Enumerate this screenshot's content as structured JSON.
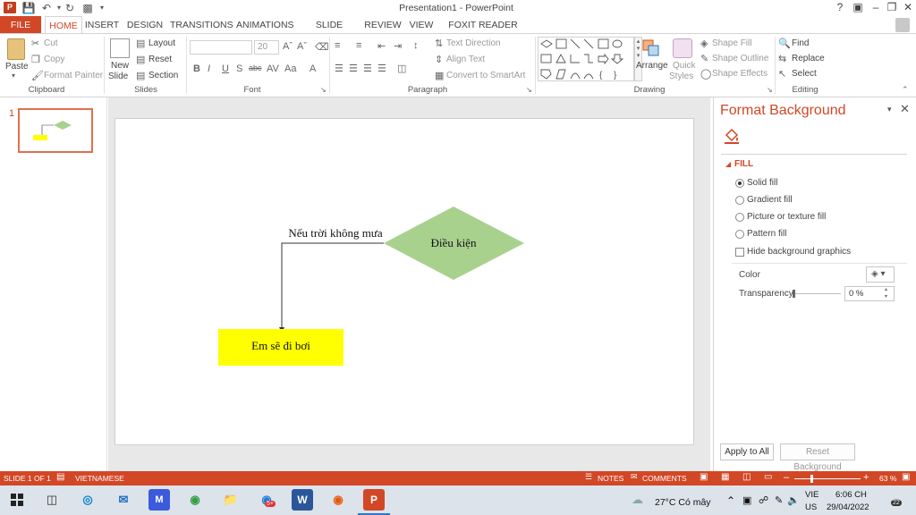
{
  "window": {
    "title": "Presentation1 - PowerPoint",
    "app_icon": "P"
  },
  "tabs": {
    "file": "FILE",
    "home": "HOME",
    "insert": "INSERT",
    "design": "DESIGN",
    "transitions": "TRANSITIONS",
    "animations": "ANIMATIONS",
    "slide_show": "SLIDE SHOW",
    "review": "REVIEW",
    "view": "VIEW",
    "foxit": "FOXIT READER PDF"
  },
  "ribbon": {
    "clipboard": {
      "paste": "Paste",
      "cut": "Cut",
      "copy": "Copy",
      "format_painter": "Format Painter",
      "label": "Clipboard"
    },
    "slides": {
      "new_slide_1": "New",
      "new_slide_2": "Slide",
      "layout": "Layout",
      "reset": "Reset",
      "section": "Section",
      "label": "Slides"
    },
    "font": {
      "size": "20",
      "label": "Font"
    },
    "paragraph": {
      "text_direction": "Text Direction",
      "align_text": "Align Text",
      "convert_smartart": "Convert to SmartArt",
      "label": "Paragraph"
    },
    "drawing": {
      "arrange": "Arrange",
      "quick_styles_1": "Quick",
      "quick_styles_2": "Styles",
      "shape_fill": "Shape Fill",
      "shape_outline": "Shape Outline",
      "shape_effects": "Shape Effects",
      "label": "Drawing"
    },
    "editing": {
      "find": "Find",
      "replace": "Replace",
      "select": "Select",
      "label": "Editing"
    }
  },
  "thumbnails": {
    "slide_number": "1"
  },
  "slide": {
    "diamond_text": "Điều kiện",
    "connector_label": "Nếu trời không mưa",
    "box_text": "Em sẽ đi bơi"
  },
  "format_pane": {
    "title": "Format Background",
    "section": "FILL",
    "options": [
      "Solid fill",
      "Gradient fill",
      "Picture or texture fill",
      "Pattern fill"
    ],
    "hide_bg": "Hide background graphics",
    "color_label": "Color",
    "transparency_label": "Transparency",
    "transparency_value": "0 %",
    "apply_all": "Apply to All",
    "reset_bg": "Reset Background"
  },
  "status": {
    "slide_of": "SLIDE 1 OF 1",
    "language": "VIETNAMESE",
    "notes": "NOTES",
    "comments": "COMMENTS",
    "zoom": "63 %"
  },
  "taskbar": {
    "weather": "27°C  Có mây",
    "lang_1": "VIE",
    "lang_2": "US",
    "time": "6:06 CH",
    "date": "29/04/2022",
    "notif": "22",
    "chrome_badge": "5+"
  },
  "colors": {
    "accent": "#d24726",
    "diamond": "#a9d18e",
    "box": "#ffff00"
  }
}
